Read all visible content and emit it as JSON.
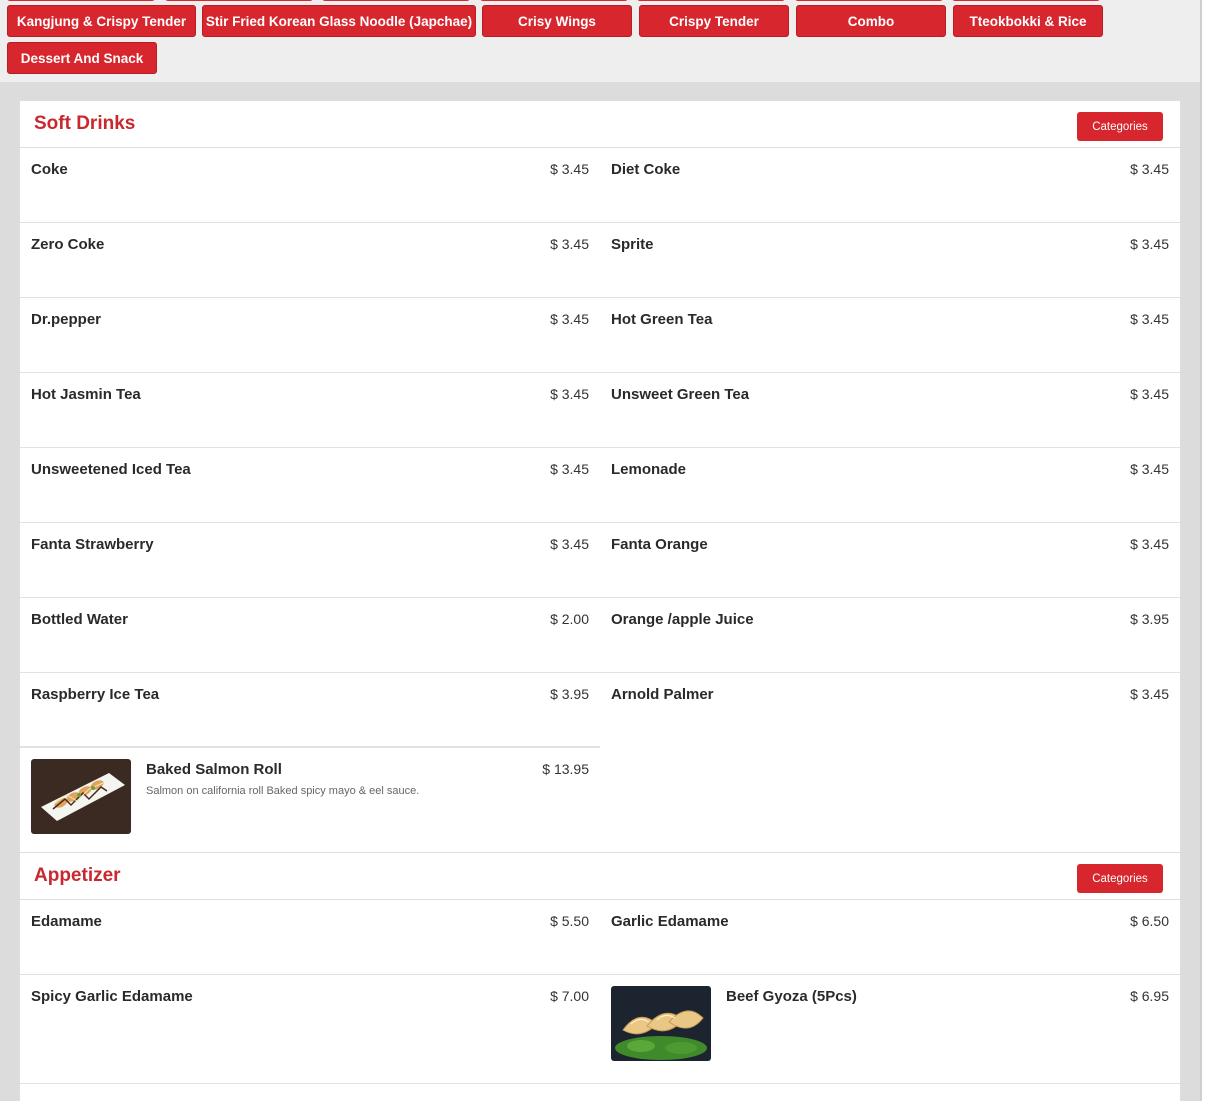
{
  "categories_bar": {
    "row1": [
      {
        "label": "Kangjung & Crispy Tender"
      },
      {
        "label": "Stir Fried Korean Glass Noodle (Japchae)"
      },
      {
        "label": "Crisy Wings"
      },
      {
        "label": "Crispy Tender"
      },
      {
        "label": "Combo"
      },
      {
        "label": "Tteokbokki & Rice"
      }
    ],
    "row2": [
      {
        "label": "Dessert And Snack"
      }
    ]
  },
  "sections": {
    "soft_drinks": {
      "title": "Soft Drinks",
      "categories_label": "Categories",
      "items": [
        {
          "name": "Coke",
          "price": "$ 3.45"
        },
        {
          "name": "Diet Coke",
          "price": "$ 3.45"
        },
        {
          "name": "Zero Coke",
          "price": "$ 3.45"
        },
        {
          "name": "Sprite",
          "price": "$ 3.45"
        },
        {
          "name": "Dr.pepper",
          "price": "$ 3.45"
        },
        {
          "name": "Hot Green Tea",
          "price": "$ 3.45"
        },
        {
          "name": "Hot Jasmin Tea",
          "price": "$ 3.45"
        },
        {
          "name": "Unsweet Green Tea",
          "price": "$ 3.45"
        },
        {
          "name": "Unsweetened Iced Tea",
          "price": "$ 3.45"
        },
        {
          "name": "Lemonade",
          "price": "$ 3.45"
        },
        {
          "name": "Fanta Strawberry",
          "price": "$ 3.45"
        },
        {
          "name": "Fanta Orange",
          "price": "$ 3.45"
        },
        {
          "name": "Bottled Water",
          "price": "$ 2.00"
        },
        {
          "name": "Orange /apple Juice",
          "price": "$ 3.95"
        },
        {
          "name": "Raspberry Ice Tea",
          "price": "$ 3.95"
        },
        {
          "name": "Arnold Palmer",
          "price": "$ 3.45"
        },
        {
          "name": "Baked Salmon Roll",
          "price": "$ 13.95",
          "description": "Salmon on california roll Baked spicy mayo & eel sauce."
        }
      ]
    },
    "appetizer": {
      "title": "Appetizer",
      "categories_label": "Categories",
      "items": [
        {
          "name": "Edamame",
          "price": "$ 5.50"
        },
        {
          "name": "Garlic Edamame",
          "price": "$ 6.50"
        },
        {
          "name": "Spicy Garlic Edamame",
          "price": "$ 7.00"
        },
        {
          "name": "Beef Gyoza (5Pcs)",
          "price": "$ 6.95"
        }
      ]
    }
  },
  "colors": {
    "accent": "#d7262d",
    "title": "#c8282e"
  }
}
